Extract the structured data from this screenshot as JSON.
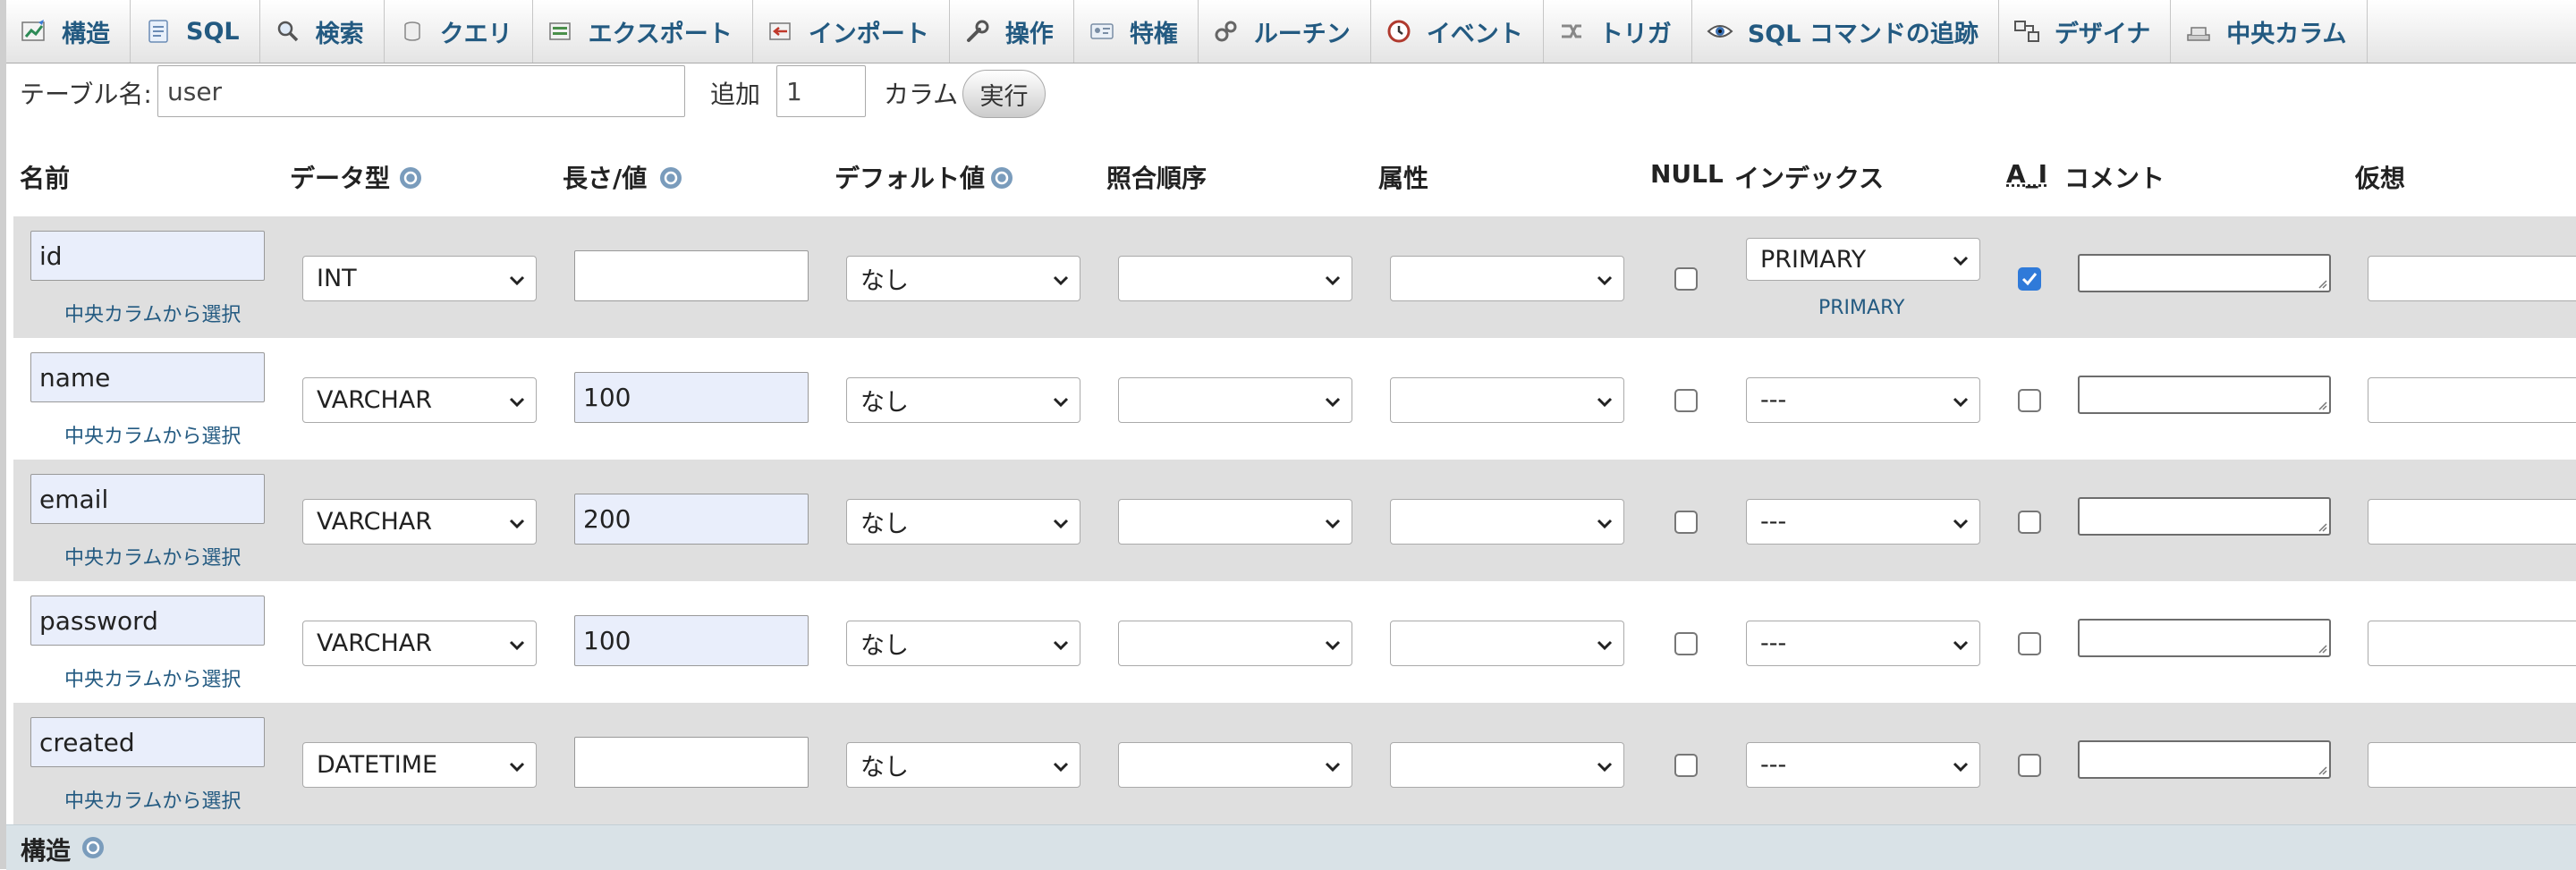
{
  "tabs": [
    {
      "label": "構造",
      "icon": "structure-icon"
    },
    {
      "label": "SQL",
      "icon": "sql-icon"
    },
    {
      "label": "検索",
      "icon": "search-icon"
    },
    {
      "label": "クエリ",
      "icon": "query-icon"
    },
    {
      "label": "エクスポート",
      "icon": "export-icon"
    },
    {
      "label": "インポート",
      "icon": "import-icon"
    },
    {
      "label": "操作",
      "icon": "wrench-icon"
    },
    {
      "label": "特権",
      "icon": "privileges-icon"
    },
    {
      "label": "ルーチン",
      "icon": "routines-icon"
    },
    {
      "label": "イベント",
      "icon": "events-icon"
    },
    {
      "label": "トリガ",
      "icon": "triggers-icon"
    },
    {
      "label": "SQL コマンドの追跡",
      "icon": "eye-icon"
    },
    {
      "label": "デザイナ",
      "icon": "designer-icon"
    },
    {
      "label": "中央カラム",
      "icon": "central-columns-icon"
    }
  ],
  "form": {
    "table_name_label": "テーブル名:",
    "table_name_value": "user",
    "add_label": "追加",
    "add_count": "1",
    "columns_label": "カラム",
    "execute_label": "実行"
  },
  "headers": {
    "name": "名前",
    "type": "データ型",
    "length": "長さ/値",
    "default": "デフォルト値",
    "collation": "照合順序",
    "attributes": "属性",
    "null": "NULL",
    "index": "インデックス",
    "ai": "A_I",
    "comment": "コメント",
    "virtual": "仮想"
  },
  "central_link_text": "中央カラムから選択",
  "rows": [
    {
      "name": "id",
      "type": "INT",
      "length": "",
      "default": "なし",
      "collation": "",
      "attributes": "",
      "null": false,
      "index": "PRIMARY",
      "index_note": "PRIMARY",
      "ai": true,
      "comment": ""
    },
    {
      "name": "name",
      "type": "VARCHAR",
      "length": "100",
      "default": "なし",
      "collation": "",
      "attributes": "",
      "null": false,
      "index": "---",
      "index_note": "",
      "ai": false,
      "comment": ""
    },
    {
      "name": "email",
      "type": "VARCHAR",
      "length": "200",
      "default": "なし",
      "collation": "",
      "attributes": "",
      "null": false,
      "index": "---",
      "index_note": "",
      "ai": false,
      "comment": ""
    },
    {
      "name": "password",
      "type": "VARCHAR",
      "length": "100",
      "default": "なし",
      "collation": "",
      "attributes": "",
      "null": false,
      "index": "---",
      "index_note": "",
      "ai": false,
      "comment": ""
    },
    {
      "name": "created",
      "type": "DATETIME",
      "length": "",
      "default": "なし",
      "collation": "",
      "attributes": "",
      "null": false,
      "index": "---",
      "index_note": "",
      "ai": false,
      "comment": ""
    }
  ],
  "footer": {
    "structure_label": "構造"
  },
  "colors": {
    "link": "#235a81",
    "help_icon": "#7a9cbc",
    "row_shade": "#dfdfdf",
    "filled_input": "#e9eefb"
  }
}
